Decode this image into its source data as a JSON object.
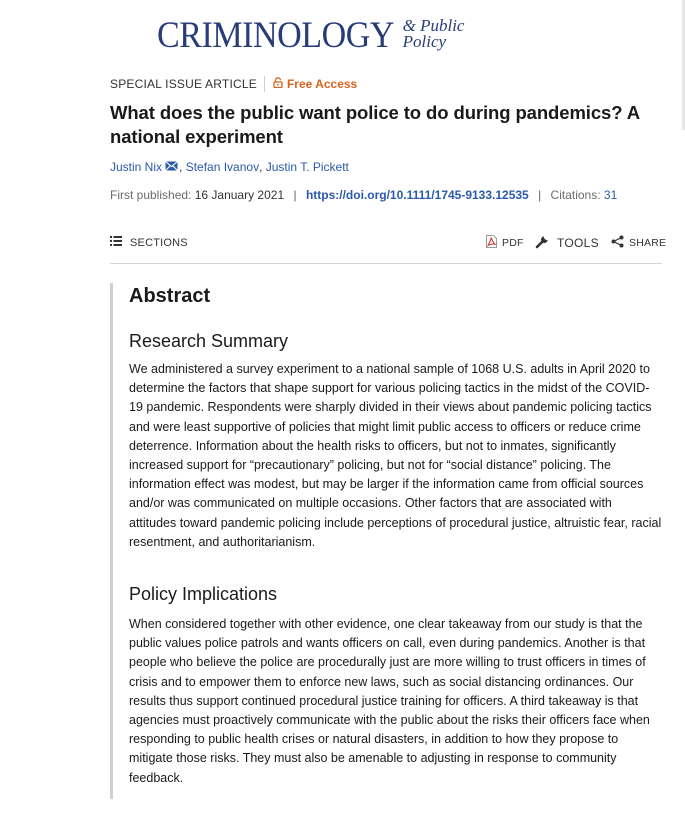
{
  "journal": {
    "name": "CRIMINOLOGY",
    "subtitle_line1": "& Public",
    "subtitle_line2": "Policy"
  },
  "article": {
    "type": "SPECIAL ISSUE ARTICLE",
    "access": "Free Access",
    "title": "What does the public want police to do during pandemics? A national experiment",
    "authors": [
      "Justin Nix",
      "Stefan Ivanov",
      "Justin T. Pickett"
    ],
    "author_separator": ", ",
    "first_published_label": "First published:",
    "first_published_date": "16 January 2021",
    "separator": "|",
    "doi": "https://doi.org/10.1111/1745-9133.12535",
    "citations_label": "Citations:",
    "citations_count": "31"
  },
  "toolbar": {
    "sections_label": "SECTIONS",
    "pdf_label": "PDF",
    "tools_label": "TOOLS",
    "share_label": "SHARE"
  },
  "abstract": {
    "heading": "Abstract",
    "research_summary_heading": "Research Summary",
    "research_summary_text": "We administered a survey experiment to a national sample of 1068 U.S. adults in April 2020 to determine the factors that shape support for various policing tactics in the midst of the COVID-19 pandemic. Respondents were sharply divided in their views about pandemic policing tactics and were least supportive of policies that might limit public access to officers or reduce crime deterrence. Information about the health risks to officers, but not to inmates, significantly increased support for “precautionary” policing, but not for “social distance” policing. The information effect was modest, but may be larger if the information came from official sources and/or was communicated on multiple occasions. Other factors that are associated with attitudes toward pandemic policing include perceptions of procedural justice, altruistic fear, racial resentment, and authoritarianism.",
    "policy_heading": "Policy Implications",
    "policy_text": "When considered together with other evidence, one clear takeaway from our study is that the public values police patrols and wants officers on call, even during pandemics. Another is that people who believe the police are procedurally just are more willing to trust officers in times of crisis and to empower them to enforce new laws, such as social distancing ordinances. Our results thus support continued procedural justice training for officers. A third takeaway is that agencies must proactively communicate with the public about the risks their officers face when responding to public health crises or natural disasters, in addition to how they propose to mitigate those risks. They must also be amenable to adjusting in response to community feedback."
  },
  "icons": {
    "lock": "lock-icon",
    "mail": "mail-icon",
    "sections": "list-icon",
    "pdf": "pdf-icon",
    "tools": "wrench-icon",
    "share": "share-icon"
  },
  "colors": {
    "brand": "#283c78",
    "link": "#2b5aa8",
    "free_access": "#d8641f",
    "pdf_red": "#d93025"
  }
}
